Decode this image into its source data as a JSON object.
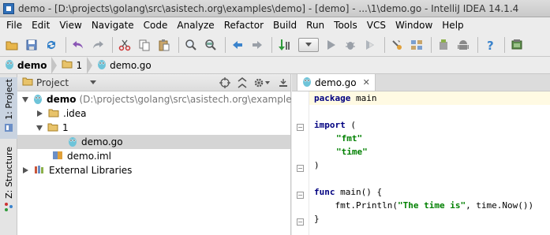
{
  "window": {
    "title": "demo - [D:\\projects\\golang\\src\\asistech.org\\examples\\demo] - [demo] - ...\\1\\demo.go - IntelliJ IDEA 14.1.4"
  },
  "menu": [
    {
      "label": "File"
    },
    {
      "label": "Edit"
    },
    {
      "label": "View"
    },
    {
      "label": "Navigate"
    },
    {
      "label": "Code"
    },
    {
      "label": "Analyze"
    },
    {
      "label": "Refactor"
    },
    {
      "label": "Build"
    },
    {
      "label": "Run"
    },
    {
      "label": "Tools"
    },
    {
      "label": "VCS"
    },
    {
      "label": "Window"
    },
    {
      "label": "Help"
    }
  ],
  "toolbar": {
    "icons": [
      "open-folder-icon",
      "save-icon",
      "sync-icon",
      "undo-icon",
      "redo-icon",
      "cut-icon",
      "copy-icon",
      "paste-icon",
      "find-icon",
      "replace-icon",
      "back-icon",
      "forward-icon",
      "make-icon",
      "run-config-combo",
      "run-icon",
      "debug-icon",
      "run-coverage-icon",
      "settings-icon",
      "project-structure-icon",
      "sdk-manager-icon",
      "android-icon",
      "help-icon",
      "terminal-icon"
    ]
  },
  "breadcrumbs": [
    {
      "label": "demo",
      "icon": "gopher-icon",
      "bold": true
    },
    {
      "label": "1",
      "icon": "folder-icon",
      "bold": false
    },
    {
      "label": "demo.go",
      "icon": "gopher-icon",
      "bold": false
    }
  ],
  "side_tabs": {
    "project": "1: Project",
    "structure": "Z: Structure"
  },
  "project_panel": {
    "view_label": "Project",
    "tree": [
      {
        "name": "demo",
        "path": "(D:\\projects\\golang\\src\\asistech.org\\examples\\demo)",
        "icon": "gopher-icon",
        "expanded": true
      },
      {
        "name": ".idea",
        "icon": "folder-icon",
        "expanded": false
      },
      {
        "name": "1",
        "icon": "folder-icon",
        "expanded": true
      },
      {
        "name": "demo.go",
        "icon": "gopher-icon",
        "selected": true
      },
      {
        "name": "demo.iml",
        "icon": "module-file-icon"
      },
      {
        "name": "External Libraries",
        "icon": "libraries-icon",
        "expanded": false
      }
    ]
  },
  "editor": {
    "tab_label": "demo.go",
    "code": {
      "package_kw": "package",
      "package_name": " main",
      "import_kw": "import",
      "import_open": " (",
      "import_fmt": "\"fmt\"",
      "import_time": "\"time\"",
      "import_close": ")",
      "func_kw": "func",
      "func_sig": " main() {",
      "call_pre": "    fmt.Println(",
      "call_str": "\"The time is\"",
      "call_post": ", time.Now())",
      "func_close": "}"
    }
  }
}
